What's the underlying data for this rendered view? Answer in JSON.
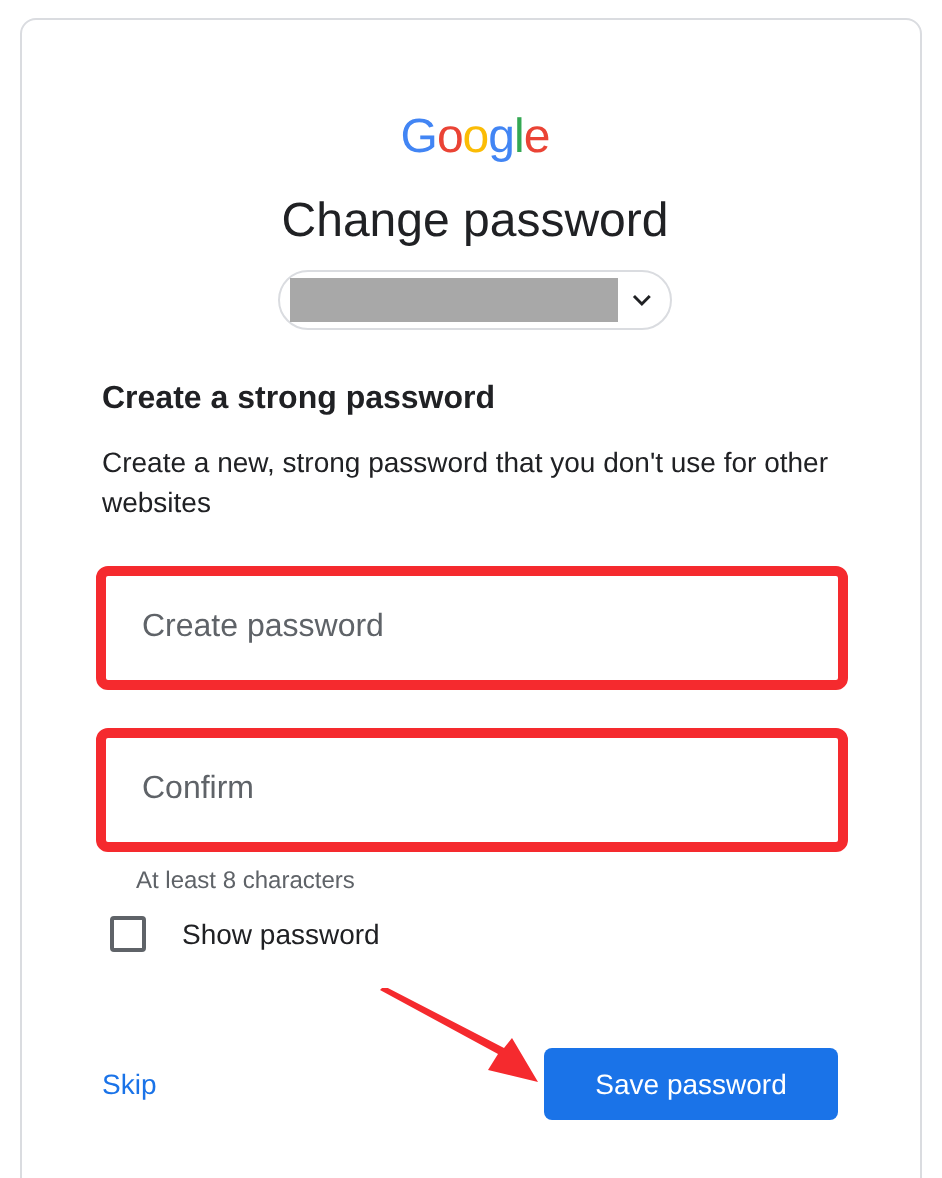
{
  "logo": "Google",
  "title": "Change password",
  "heading": "Create a strong password",
  "description": "Create a new, strong password that you don't use for other websites",
  "fields": [
    {
      "placeholder": "Create password",
      "highlighted": true
    },
    {
      "placeholder": "Confirm",
      "highlighted": true
    }
  ],
  "hint": "At least 8 characters",
  "show_password": {
    "label": "Show password",
    "checked": false
  },
  "skip": "Skip",
  "save": "Save password"
}
